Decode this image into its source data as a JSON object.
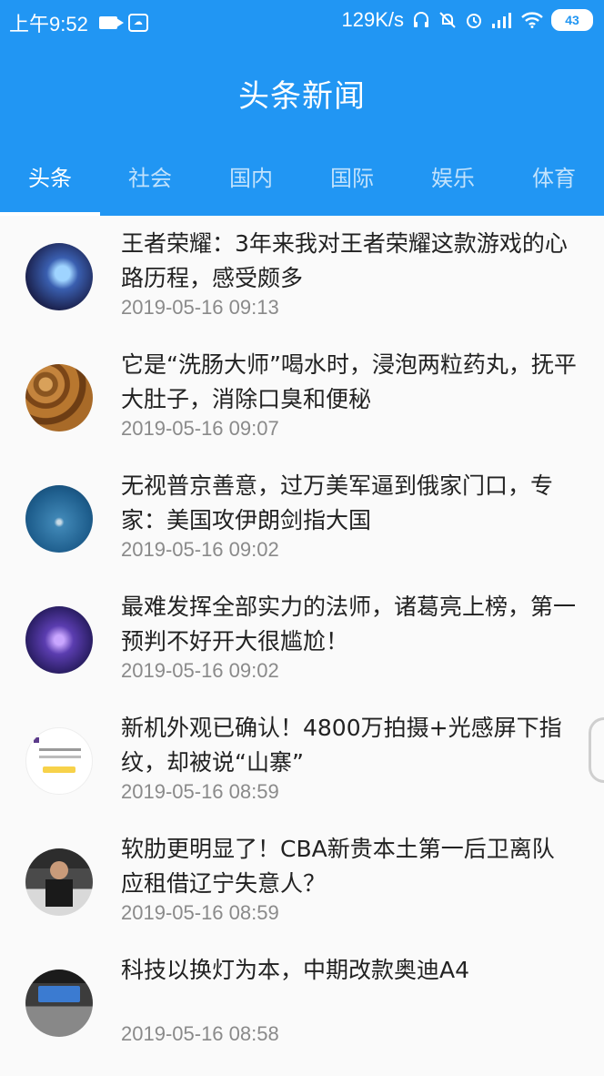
{
  "status_bar": {
    "time": "上午9:52",
    "cloud_badge": "☁",
    "net_speed": "129K/s",
    "battery": "43"
  },
  "app_bar": {
    "title": "头条新闻"
  },
  "tabs": [
    {
      "label": "头条",
      "active": true
    },
    {
      "label": "社会",
      "active": false
    },
    {
      "label": "国内",
      "active": false
    },
    {
      "label": "国际",
      "active": false
    },
    {
      "label": "娱乐",
      "active": false
    },
    {
      "label": "体育",
      "active": false
    }
  ],
  "news": [
    {
      "title": "王者荣耀：3年来我对王者荣耀这款游戏的心路历程，感受颇多",
      "time": "2019-05-16 09:13"
    },
    {
      "title": "它是“洗肠大师”喝水时，浸泡两粒药丸，抚平大肚子，消除口臭和便秘",
      "time": "2019-05-16 09:07"
    },
    {
      "title": "无视普京善意，过万美军逼到俄家门口，专家：美国攻伊朗剑指大国",
      "time": "2019-05-16 09:02"
    },
    {
      "title": "最难发挥全部实力的法师，诸葛亮上榜，第一预判不好开大很尴尬！",
      "time": "2019-05-16 09:02"
    },
    {
      "title": "新机外观已确认！4800万拍摄+光感屏下指纹，却被说“山寨”",
      "time": "2019-05-16 08:59"
    },
    {
      "title": "软肋更明显了！CBA新贵本土第一后卫离队 应租借辽宁失意人？",
      "time": "2019-05-16 08:59"
    },
    {
      "title": "科技以换灯为本，中期改款奥迪A4",
      "time": "2019-05-16 08:58"
    }
  ],
  "colors": {
    "primary": "#2196f3"
  }
}
